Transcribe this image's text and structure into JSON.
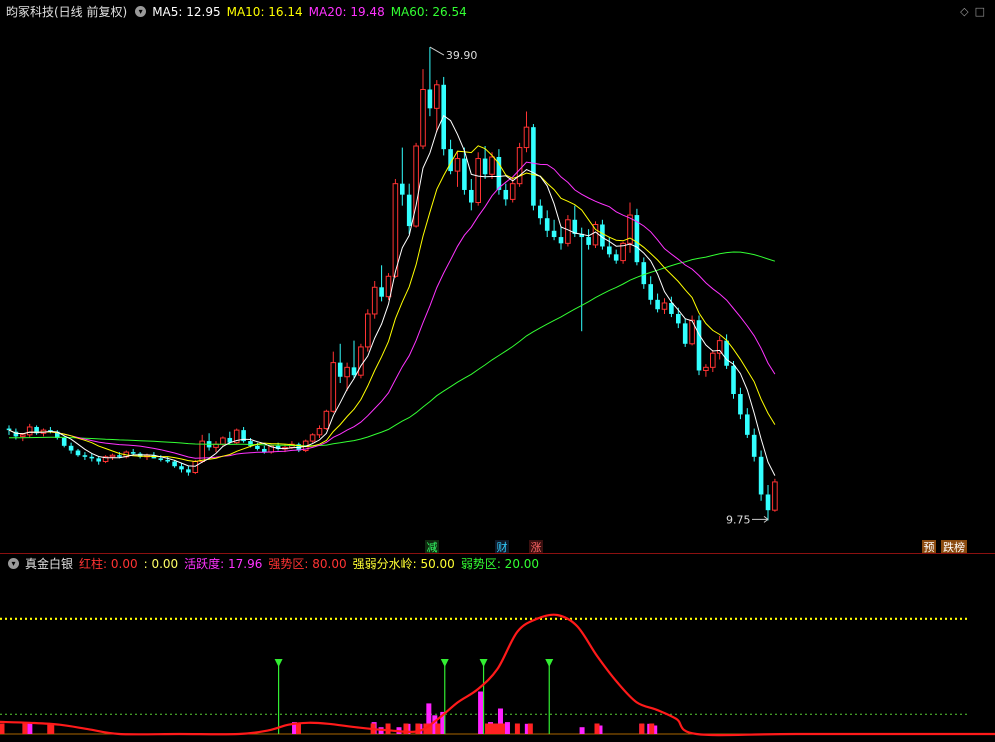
{
  "header": {
    "title": "昀冢科技(日线 前复权)",
    "ma": [
      {
        "label": "MA5: 12.95",
        "color": "#ffffff"
      },
      {
        "label": "MA10: 16.14",
        "color": "#ffff00"
      },
      {
        "label": "MA20: 19.48",
        "color": "#ff33ff"
      },
      {
        "label": "MA60: 26.54",
        "color": "#33ff33"
      }
    ]
  },
  "indicator": {
    "title": "真金白银",
    "items": [
      {
        "label": "红柱: 0.00",
        "color": "#ff3333"
      },
      {
        "label": ": 0.00",
        "color": "#ffff66"
      },
      {
        "label": "活跃度: 17.96",
        "color": "#ff33ff"
      },
      {
        "label": "强势区: 80.00",
        "color": "#ff3333"
      },
      {
        "label": "强弱分水岭: 50.00",
        "color": "#ffff33"
      },
      {
        "label": "弱势区: 20.00",
        "color": "#33ff33"
      }
    ]
  },
  "markers": {
    "high": "39.90",
    "low": "9.75",
    "jian": "减",
    "cai": "财",
    "zhang": "涨",
    "yu": "预",
    "diebang": "跌榜"
  },
  "colors": {
    "up": "#ff3333",
    "down": "#33ffff",
    "ma5": "#ffffff",
    "ma10": "#ffff00",
    "ma20": "#ff33ff",
    "ma60": "#33ff33"
  },
  "chart_data": [
    {
      "type": "candlestick",
      "title": "昀冢科技(日线 前复权)",
      "annotations": {
        "max": 39.9,
        "min": 9.75
      },
      "ylim": [
        8.5,
        41.5
      ],
      "candles": [
        [
          15.6,
          15.8,
          15.2,
          15.5
        ],
        [
          15.4,
          15.6,
          14.9,
          15.1
        ],
        [
          15.1,
          15.3,
          14.8,
          15.2
        ],
        [
          15.2,
          15.9,
          15.0,
          15.7
        ],
        [
          15.7,
          15.8,
          15.2,
          15.3
        ],
        [
          15.3,
          15.6,
          15.1,
          15.5
        ],
        [
          15.5,
          15.7,
          15.3,
          15.4
        ],
        [
          15.4,
          15.5,
          14.9,
          15.0
        ],
        [
          15.0,
          15.1,
          14.4,
          14.5
        ],
        [
          14.5,
          14.7,
          14.0,
          14.2
        ],
        [
          14.2,
          14.3,
          13.8,
          13.9
        ],
        [
          13.9,
          14.1,
          13.6,
          13.8
        ],
        [
          13.8,
          14.0,
          13.5,
          13.7
        ],
        [
          13.7,
          13.8,
          13.3,
          13.5
        ],
        [
          13.5,
          13.9,
          13.4,
          13.8
        ],
        [
          13.8,
          14.0,
          13.6,
          13.9
        ],
        [
          13.9,
          14.1,
          13.7,
          13.8
        ],
        [
          13.8,
          14.2,
          13.7,
          14.1
        ],
        [
          14.1,
          14.3,
          13.9,
          14.0
        ],
        [
          14.0,
          14.1,
          13.7,
          13.8
        ],
        [
          13.8,
          14.0,
          13.6,
          13.9
        ],
        [
          13.9,
          14.1,
          13.7,
          13.7
        ],
        [
          13.7,
          13.9,
          13.5,
          13.6
        ],
        [
          13.6,
          13.8,
          13.4,
          13.5
        ],
        [
          13.5,
          13.6,
          13.1,
          13.2
        ],
        [
          13.2,
          13.4,
          12.8,
          13.0
        ],
        [
          13.0,
          13.2,
          12.6,
          12.8
        ],
        [
          12.8,
          13.6,
          12.7,
          13.5
        ],
        [
          13.5,
          15.2,
          13.4,
          14.8
        ],
        [
          14.8,
          15.3,
          14.2,
          14.4
        ],
        [
          14.4,
          14.8,
          14.1,
          14.6
        ],
        [
          14.6,
          15.1,
          14.5,
          15.0
        ],
        [
          15.0,
          15.4,
          14.6,
          14.7
        ],
        [
          14.7,
          15.6,
          14.6,
          15.5
        ],
        [
          15.5,
          15.7,
          14.7,
          14.8
        ],
        [
          14.8,
          15.0,
          14.4,
          14.5
        ],
        [
          14.5,
          14.7,
          14.2,
          14.3
        ],
        [
          14.3,
          14.5,
          14.0,
          14.1
        ],
        [
          14.1,
          14.6,
          14.0,
          14.5
        ],
        [
          14.5,
          14.7,
          14.2,
          14.3
        ],
        [
          14.3,
          14.6,
          14.1,
          14.4
        ],
        [
          14.4,
          14.8,
          14.3,
          14.6
        ],
        [
          14.6,
          14.7,
          14.1,
          14.2
        ],
        [
          14.2,
          14.9,
          14.1,
          14.8
        ],
        [
          14.8,
          15.3,
          14.7,
          15.2
        ],
        [
          15.2,
          15.8,
          15.0,
          15.6
        ],
        [
          15.6,
          16.8,
          15.5,
          16.7
        ],
        [
          16.7,
          20.5,
          16.6,
          19.8
        ],
        [
          19.8,
          21.0,
          18.5,
          18.9
        ],
        [
          18.9,
          19.8,
          18.0,
          19.5
        ],
        [
          19.5,
          21.2,
          18.8,
          19.0
        ],
        [
          19.0,
          21.0,
          18.8,
          20.8
        ],
        [
          20.8,
          23.2,
          20.5,
          22.9
        ],
        [
          22.9,
          25.0,
          22.6,
          24.6
        ],
        [
          24.6,
          26.0,
          23.7,
          24.0
        ],
        [
          24.0,
          25.5,
          23.8,
          25.3
        ],
        [
          25.3,
          31.5,
          25.2,
          31.2
        ],
        [
          31.2,
          33.5,
          29.8,
          30.5
        ],
        [
          30.5,
          31.2,
          28.0,
          28.5
        ],
        [
          28.5,
          33.8,
          28.4,
          33.6
        ],
        [
          33.6,
          38.5,
          33.4,
          37.2
        ],
        [
          37.2,
          39.9,
          35.5,
          36.0
        ],
        [
          36.0,
          37.8,
          34.5,
          37.5
        ],
        [
          37.5,
          38.0,
          33.0,
          33.4
        ],
        [
          33.4,
          34.0,
          31.8,
          32.0
        ],
        [
          32.0,
          33.2,
          31.0,
          32.8
        ],
        [
          32.8,
          33.5,
          30.5,
          30.8
        ],
        [
          30.8,
          31.5,
          29.5,
          30.0
        ],
        [
          30.0,
          33.2,
          29.8,
          32.8
        ],
        [
          32.8,
          33.6,
          31.5,
          31.8
        ],
        [
          31.8,
          33.2,
          31.5,
          32.9
        ],
        [
          32.9,
          33.4,
          30.5,
          30.8
        ],
        [
          30.8,
          31.2,
          29.8,
          30.2
        ],
        [
          30.2,
          31.5,
          30.0,
          31.2
        ],
        [
          31.2,
          33.8,
          31.0,
          33.5
        ],
        [
          33.5,
          35.8,
          33.2,
          34.8
        ],
        [
          34.8,
          35.0,
          29.5,
          29.8
        ],
        [
          29.8,
          30.2,
          28.6,
          29.0
        ],
        [
          29.0,
          29.5,
          27.8,
          28.2
        ],
        [
          28.2,
          28.9,
          27.6,
          27.8
        ],
        [
          27.8,
          28.5,
          27.0,
          27.4
        ],
        [
          27.4,
          29.2,
          27.2,
          28.9
        ],
        [
          28.9,
          29.8,
          27.8,
          28.0
        ],
        [
          28.0,
          28.4,
          21.8,
          27.8
        ],
        [
          27.8,
          28.3,
          27.0,
          27.3
        ],
        [
          27.3,
          28.8,
          27.1,
          28.6
        ],
        [
          28.6,
          28.9,
          27.0,
          27.2
        ],
        [
          27.2,
          27.8,
          26.5,
          26.7
        ],
        [
          26.7,
          27.0,
          26.1,
          26.3
        ],
        [
          26.3,
          27.5,
          26.1,
          27.4
        ],
        [
          27.4,
          30.0,
          26.8,
          29.2
        ],
        [
          29.2,
          29.6,
          26.0,
          26.2
        ],
        [
          26.2,
          26.5,
          24.5,
          24.8
        ],
        [
          24.8,
          25.3,
          23.5,
          23.8
        ],
        [
          23.8,
          24.2,
          23.0,
          23.2
        ],
        [
          23.2,
          23.9,
          22.9,
          23.6
        ],
        [
          23.6,
          24.0,
          22.7,
          22.9
        ],
        [
          22.9,
          23.3,
          22.0,
          22.3
        ],
        [
          22.3,
          22.6,
          20.8,
          21.0
        ],
        [
          21.0,
          22.8,
          20.9,
          22.5
        ],
        [
          22.5,
          22.8,
          19.0,
          19.3
        ],
        [
          19.3,
          19.7,
          18.9,
          19.5
        ],
        [
          19.5,
          20.6,
          19.2,
          20.4
        ],
        [
          20.4,
          21.5,
          20.0,
          21.2
        ],
        [
          21.2,
          21.6,
          19.4,
          19.6
        ],
        [
          19.6,
          19.9,
          17.5,
          17.8
        ],
        [
          17.8,
          18.2,
          16.2,
          16.5
        ],
        [
          16.5,
          16.9,
          15.0,
          15.2
        ],
        [
          15.2,
          15.6,
          13.5,
          13.8
        ],
        [
          13.8,
          14.2,
          11.0,
          11.4
        ],
        [
          11.4,
          12.0,
          9.75,
          10.4
        ],
        [
          10.4,
          12.4,
          10.3,
          12.2
        ]
      ]
    },
    {
      "type": "bar+line",
      "title": "真金白银",
      "ylim": [
        0,
        100
      ],
      "reference_lines": [
        80,
        50,
        20
      ],
      "red_line": [
        [
          0,
          6.5
        ],
        [
          0.03,
          6
        ],
        [
          0.06,
          5
        ],
        [
          0.09,
          2.5
        ],
        [
          0.12,
          0
        ],
        [
          0.18,
          0
        ],
        [
          0.24,
          0
        ],
        [
          0.27,
          2
        ],
        [
          0.29,
          5
        ],
        [
          0.31,
          6
        ],
        [
          0.33,
          5.5
        ],
        [
          0.36,
          3.5
        ],
        [
          0.39,
          2
        ],
        [
          0.42,
          1.5
        ],
        [
          0.44,
          8
        ],
        [
          0.46,
          17
        ],
        [
          0.48,
          24
        ],
        [
          0.5,
          35
        ],
        [
          0.52,
          55
        ],
        [
          0.54,
          62
        ],
        [
          0.56,
          64
        ],
        [
          0.58,
          58
        ],
        [
          0.6,
          42
        ],
        [
          0.62,
          28
        ],
        [
          0.64,
          17
        ],
        [
          0.66,
          13
        ],
        [
          0.68,
          8
        ],
        [
          0.7,
          0
        ],
        [
          0.8,
          0
        ],
        [
          1.0,
          0
        ]
      ],
      "magenta_bars": [
        [
          0.03,
          7
        ],
        [
          0.296,
          7
        ],
        [
          0.376,
          7
        ],
        [
          0.383,
          4
        ],
        [
          0.401,
          4
        ],
        [
          0.41,
          6
        ],
        [
          0.422,
          6
        ],
        [
          0.431,
          18
        ],
        [
          0.437,
          11
        ],
        [
          0.445,
          13
        ],
        [
          0.483,
          25
        ],
        [
          0.493,
          7
        ],
        [
          0.503,
          15
        ],
        [
          0.51,
          7
        ],
        [
          0.53,
          6
        ],
        [
          0.585,
          4
        ],
        [
          0.603,
          5
        ],
        [
          0.645,
          6
        ],
        [
          0.653,
          6
        ],
        [
          0.658,
          5
        ]
      ],
      "red_bars": [
        [
          0.002,
          3
        ],
        [
          0.025,
          3
        ],
        [
          0.05,
          3
        ],
        [
          0.052,
          3
        ],
        [
          0.3,
          3
        ],
        [
          0.375,
          3
        ],
        [
          0.39,
          3
        ],
        [
          0.408,
          3
        ],
        [
          0.42,
          3
        ],
        [
          0.428,
          3
        ],
        [
          0.432,
          3
        ],
        [
          0.44,
          3
        ],
        [
          0.49,
          3
        ],
        [
          0.495,
          3
        ],
        [
          0.5,
          3
        ],
        [
          0.505,
          3
        ],
        [
          0.52,
          3
        ],
        [
          0.533,
          3
        ],
        [
          0.6,
          3
        ],
        [
          0.645,
          3
        ],
        [
          0.655,
          3
        ]
      ],
      "green_arrows": [
        0.28,
        0.447,
        0.486,
        0.552
      ]
    }
  ]
}
